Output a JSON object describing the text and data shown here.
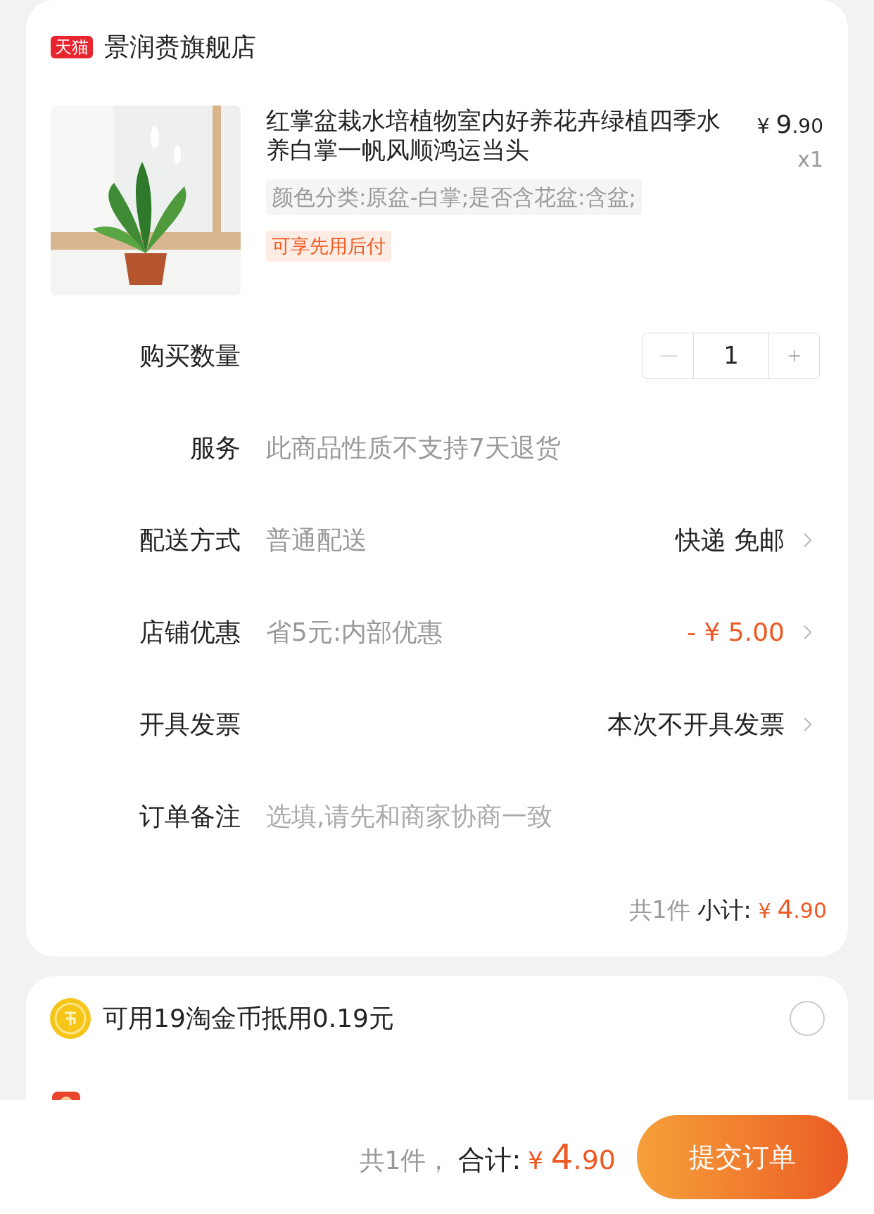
{
  "store": {
    "badge": "天猫",
    "name": "景润赉旗舰店"
  },
  "product": {
    "kind": "picture",
    "title": "红掌盆栽水培植物室内好养花卉绿植四季水养白掌一帆风顺鸿运当头",
    "currency": "¥",
    "price_int": "9",
    "price_dec": ".90",
    "quantity": "x1",
    "spec": "颜色分类:原盆-白掌;是否含花盆:含盆;",
    "tag": "可享先用后付"
  },
  "quantity": {
    "label": "购买数量",
    "value": "1",
    "decrement_disabled": true
  },
  "rows": [
    {
      "kind": "info",
      "label": "服务",
      "value": "此商品性质不支持7天退货"
    },
    {
      "kind": "option",
      "label": "配送方式",
      "value": "普通配送",
      "detail": "快递 免邮",
      "highlight": false
    },
    {
      "kind": "option",
      "label": "店铺优惠",
      "value": "省5元:内部优惠",
      "detail": "- ¥ 5.00",
      "highlight": true
    },
    {
      "kind": "option",
      "label": "开具发票",
      "detail": "本次不开具发票",
      "highlight": false
    },
    {
      "kind": "input",
      "label": "订单备注",
      "placeholder": "选填,请先和商家协商一致"
    }
  ],
  "subtotal": {
    "count": "共1件",
    "label": "小计:",
    "currency": "¥",
    "int": "4",
    "dec": ".90"
  },
  "coins": {
    "text": "可用19淘金币抵用0.19元",
    "selected": false
  },
  "footer": {
    "count": "共1件，",
    "label": "合计:",
    "currency": "¥",
    "int": "4",
    "dec": ".90",
    "submit": "提交订单"
  }
}
